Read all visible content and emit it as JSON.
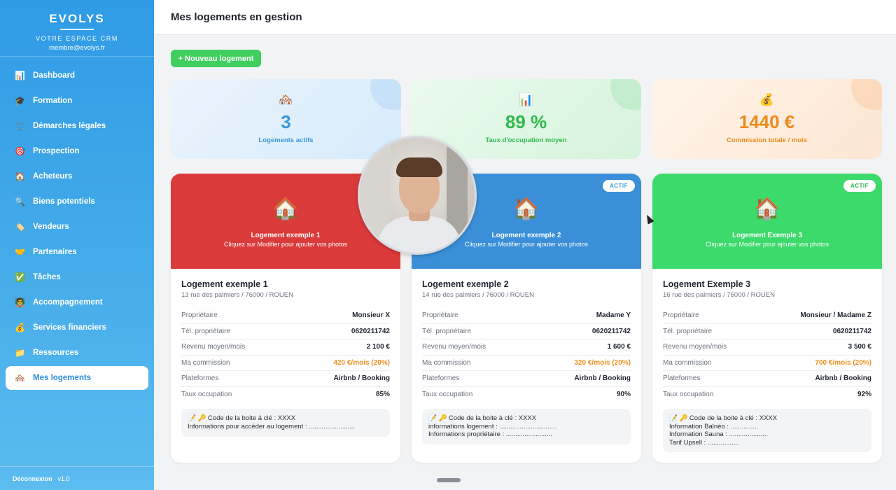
{
  "sidebar": {
    "brand": "EVOLYS",
    "subtitle": "VOTRE ESPACE CRM",
    "email": "membre@evolys.fr",
    "items": [
      {
        "icon": "📊",
        "label": "Dashboard"
      },
      {
        "icon": "🎓",
        "label": "Formation"
      },
      {
        "icon": "⚖️",
        "label": "Démarches légales"
      },
      {
        "icon": "🎯",
        "label": "Prospection"
      },
      {
        "icon": "🏠",
        "label": "Acheteurs"
      },
      {
        "icon": "🔍",
        "label": "Biens potentiels"
      },
      {
        "icon": "🏷️",
        "label": "Vendeurs"
      },
      {
        "icon": "🤝",
        "label": "Partenaires"
      },
      {
        "icon": "✅",
        "label": "Tâches"
      },
      {
        "icon": "🧑‍🏫",
        "label": "Accompagnement"
      },
      {
        "icon": "💰",
        "label": "Services financiers"
      },
      {
        "icon": "📁",
        "label": "Ressources"
      },
      {
        "icon": "🏘️",
        "label": "Mes logements"
      }
    ],
    "active_index": 12,
    "footer_link": "Déconnexion",
    "footer_version": "· v1.0"
  },
  "header": {
    "title": "Mes logements en gestion"
  },
  "new_button": "+ Nouveau logement",
  "stats": [
    {
      "icon": "🏘️",
      "value": "3",
      "label": "Logements actifs"
    },
    {
      "icon": "📊",
      "value": "89 %",
      "label": "Taux d'occupation moyen"
    },
    {
      "icon": "💰",
      "value": "1440 €",
      "label": "Commission totale / mois"
    }
  ],
  "labels": {
    "owner": "Propriétaire",
    "phone": "Tél. propriétaire",
    "income": "Revenu moyen/mois",
    "commission": "Ma commission",
    "platforms": "Plateformes",
    "occupancy": "Taux occupation"
  },
  "properties": [
    {
      "header_name": "Logement exemple 1",
      "header_sub": "Cliquez sur Modifier pour ajouter vos photos",
      "badge": "",
      "title": "Logement exemple 1",
      "address": "13 rue des palmiers / 76000 / ROUEN",
      "owner": "Monsieur X",
      "phone": "0620211742",
      "income": "2 100 €",
      "commission": "420 €/mois (20%)",
      "platforms": "Airbnb / Booking",
      "occupancy": "85%",
      "notes": [
        "📝 🔑 Code de la boite à clé : XXXX",
        "Informations pour accéder au logement : ........................."
      ]
    },
    {
      "header_name": "Logement exemple 2",
      "header_sub": "Cliquez sur Modifier pour ajouter vos photos",
      "badge": "ACTIF",
      "title": "Logement exemple 2",
      "address": "14 rue des palmiers / 76000 / ROUEN",
      "owner": "Madame Y",
      "phone": "0620211742",
      "income": "1 600 €",
      "commission": "320 €/mois (20%)",
      "platforms": "Airbnb / Booking",
      "occupancy": "90%",
      "notes": [
        "📝 🔑 Code de la boite à clé : XXXX",
        "informations logement : ...............................",
        "Informations propriétaire : ........................."
      ]
    },
    {
      "header_name": "Logement Exemple 3",
      "header_sub": "Cliquez sur Modifier pour ajouter vos photos",
      "badge": "ACTIF",
      "title": "Logement Exemple 3",
      "address": "16 rue des palmiers / 76000 / ROUEN",
      "owner": "Monsieur / Madame Z",
      "phone": "0620211742",
      "income": "3 500 €",
      "commission": "700 €/mois (20%)",
      "platforms": "Airbnb / Booking",
      "occupancy": "92%",
      "notes": [
        "📝 🔑 Code de la boite à clé : XXXX",
        "Information Balnéo : ...............",
        "Information Sauna : .....................",
        "Tarif Upsell : ................."
      ]
    }
  ]
}
